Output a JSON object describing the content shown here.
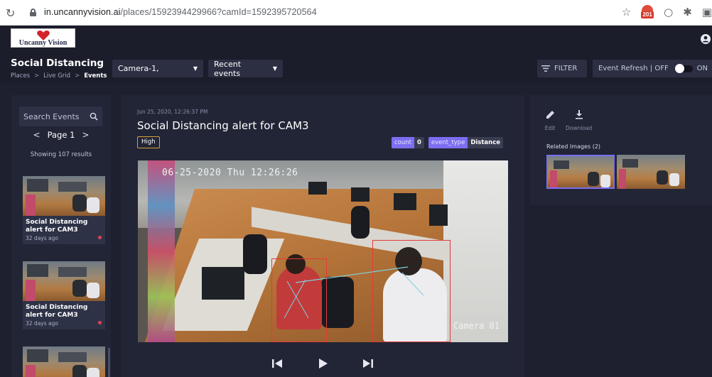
{
  "browser": {
    "url_host": "in.uncannyvision.ai",
    "url_path": "/places/1592394429966?camId=1592395720564",
    "notification_count": "201"
  },
  "app": {
    "logo_text": "Uncanny Vision",
    "page_title": "Social Distancing",
    "breadcrumb": [
      "Places",
      "Live Grid",
      "Events"
    ],
    "camera_select": "Camera-1,",
    "events_select": "Recent events",
    "filter_label": "FILTER",
    "refresh_label": "Event Refresh | OFF",
    "refresh_on_label": "ON"
  },
  "sidebar": {
    "search_placeholder": "Search Events",
    "page_label": "Page 1",
    "showing": "Showing 107 results",
    "events": [
      {
        "title": "Social Distancing alert for CAM3",
        "ago": "32 days ago"
      },
      {
        "title": "Social Distancing alert for CAM3",
        "ago": "32 days ago"
      },
      {
        "title": "",
        "ago": ""
      }
    ]
  },
  "event": {
    "timestamp": "Jun 25, 2020, 12:26:37 PM",
    "title": "Social Distancing alert for CAM3",
    "severity": "High",
    "tags": [
      {
        "key": "count",
        "value": "0"
      },
      {
        "key": "event_type",
        "value": "Distance"
      }
    ],
    "video_overlay": "06-25-2020 Thu 12:26:26",
    "camera_label": "Camera 01"
  },
  "details": {
    "edit_label": "Edit",
    "download_label": "Download",
    "related_label": "Related Images",
    "related_count": "(2)"
  },
  "colors": {
    "accent": "#7b6ef2",
    "severity_high": "#d9a23a",
    "alert_dot": "#e0435a"
  }
}
